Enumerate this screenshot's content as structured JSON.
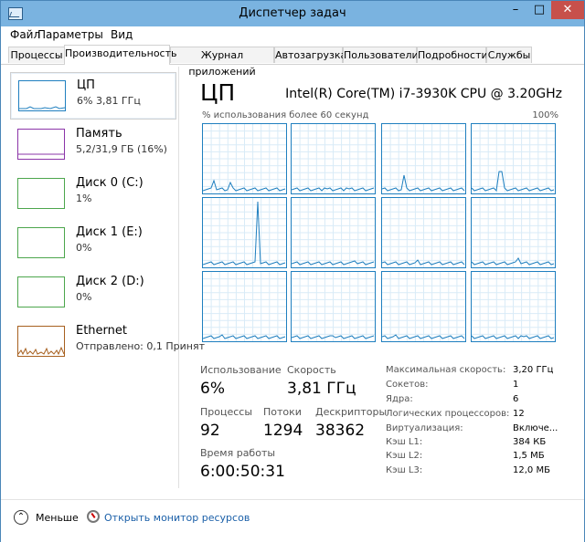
{
  "window": {
    "title": "Диспетчер задач",
    "buttons": {
      "minimize": "–",
      "maximize": "□",
      "close": "✕"
    }
  },
  "menu": [
    "Файл",
    "Параметры",
    "Вид"
  ],
  "tabs": [
    "Процессы",
    "Производительность",
    "Журнал приложений",
    "Автозагрузка",
    "Пользователи",
    "Подробности",
    "Службы"
  ],
  "sidebar": [
    {
      "title": "ЦП",
      "subtitle": "6% 3,81 ГГц",
      "color": "#1f7fbf"
    },
    {
      "title": "Память",
      "subtitle": "5,2/31,9 ГБ (16%)",
      "color": "#8b34a8"
    },
    {
      "title": "Диск 0 (C:)",
      "subtitle": "1%",
      "color": "#4ca64c"
    },
    {
      "title": "Диск 1 (E:)",
      "subtitle": "0%",
      "color": "#4ca64c"
    },
    {
      "title": "Диск 2 (D:)",
      "subtitle": "0%",
      "color": "#4ca64c"
    },
    {
      "title": "Ethernet",
      "subtitle": "Отправлено: 0,1 Принят",
      "color": "#a7601f"
    }
  ],
  "main": {
    "title": "ЦП",
    "model": "Intel(R) Core(TM) i7-3930K CPU @ 3.20GHz",
    "graph_label": "% использования более 60 секунд",
    "graph_max": "100%",
    "accent": "#1f7fbf"
  },
  "stats": {
    "usage_label": "Использование",
    "usage_value": "6%",
    "speed_label": "Скорость",
    "speed_value": "3,81 ГГц",
    "processes_label": "Процессы",
    "processes_value": "92",
    "threads_label": "Потоки",
    "threads_value": "1294",
    "handles_label": "Дескрипторы",
    "handles_value": "38362",
    "uptime_label": "Время работы",
    "uptime_value": "6:00:50:31"
  },
  "info": [
    {
      "label": "Максимальная скорость:",
      "value": "3,20 ГГц"
    },
    {
      "label": "Сокетов:",
      "value": "1"
    },
    {
      "label": "Ядра:",
      "value": "6"
    },
    {
      "label": "Логических процессоров:",
      "value": "12"
    },
    {
      "label": "Виртуализация:",
      "value": "Включе..."
    },
    {
      "label": "Кэш L1:",
      "value": "384 КБ"
    },
    {
      "label": "Кэш L2:",
      "value": "1,5 МБ"
    },
    {
      "label": "Кэш L3:",
      "value": "12,0 МБ"
    }
  ],
  "footer": {
    "less": "Меньше",
    "monitor": "Открыть монитор ресурсов"
  }
}
